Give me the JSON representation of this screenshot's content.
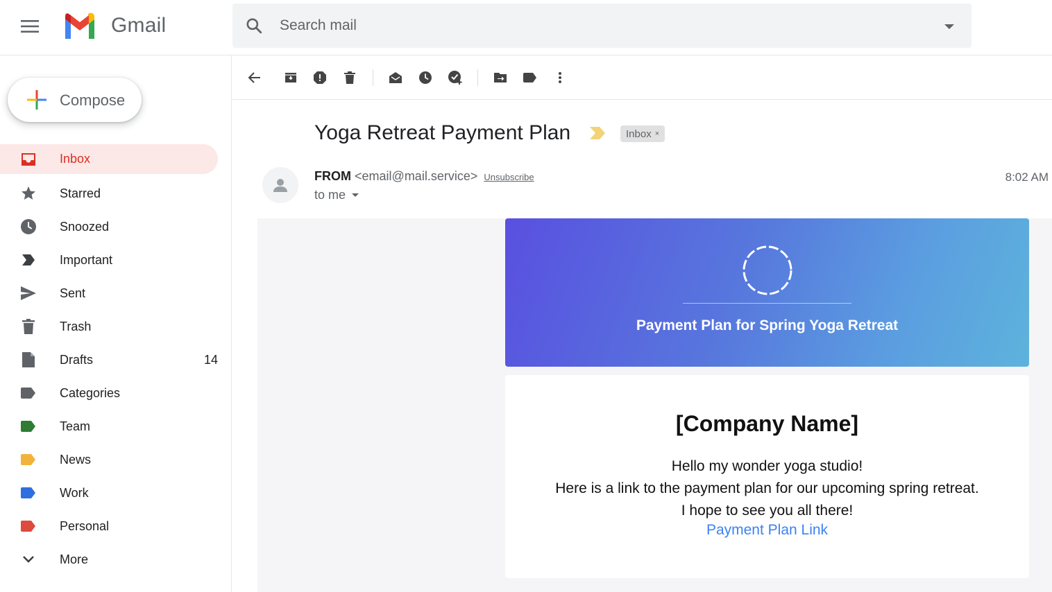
{
  "header": {
    "brand": "Gmail",
    "search_placeholder": "Search mail",
    "menu_icon": "hamburger-icon",
    "logo_icon": "gmail-logo"
  },
  "sidebar": {
    "compose_label": "Compose",
    "items": [
      {
        "label": "Inbox",
        "icon": "inbox-icon",
        "active": true,
        "count": ""
      },
      {
        "label": "Starred",
        "icon": "star-icon",
        "count": ""
      },
      {
        "label": "Snoozed",
        "icon": "clock-icon",
        "count": ""
      },
      {
        "label": "Important",
        "icon": "important-icon",
        "count": ""
      },
      {
        "label": "Sent",
        "icon": "send-icon",
        "count": ""
      },
      {
        "label": "Trash",
        "icon": "trash-icon",
        "count": ""
      },
      {
        "label": "Drafts",
        "icon": "draft-icon",
        "count": "14"
      },
      {
        "label": "Categories",
        "icon": "label-icon",
        "count": ""
      },
      {
        "label": "Team",
        "icon": "label-icon",
        "color": "#2e7d32",
        "count": ""
      },
      {
        "label": "News",
        "icon": "label-icon",
        "color": "#f2b33d",
        "count": ""
      },
      {
        "label": "Work",
        "icon": "label-icon",
        "color": "#2f6ee0",
        "count": ""
      },
      {
        "label": "Personal",
        "icon": "label-icon",
        "color": "#de4a3d",
        "count": ""
      },
      {
        "label": "More",
        "icon": "chevron-down-icon",
        "count": ""
      }
    ]
  },
  "email": {
    "subject": "Yoga Retreat Payment Plan",
    "label_chip": "Inbox",
    "label_chip_close": "×",
    "from_label": "FROM",
    "from_address": "<email@mail.service>",
    "unsubscribe": "Unsubscribe",
    "to": "to me",
    "time": "8:02 AM",
    "hero_title": "Payment Plan for Spring Yoga Retreat",
    "company": "[Company Name]",
    "greeting": "Hello my wonder yoga studio!",
    "message": "Here is a link to the payment plan for our upcoming spring retreat. I hope to see you all there!",
    "link_text": "Payment Plan Link"
  },
  "colors": {
    "accent_red": "#d93025",
    "active_bg": "#fce8e6",
    "link_blue": "#3b82f6",
    "hero_gradient_start": "#5950e0",
    "hero_gradient_end": "#5db3dc"
  }
}
